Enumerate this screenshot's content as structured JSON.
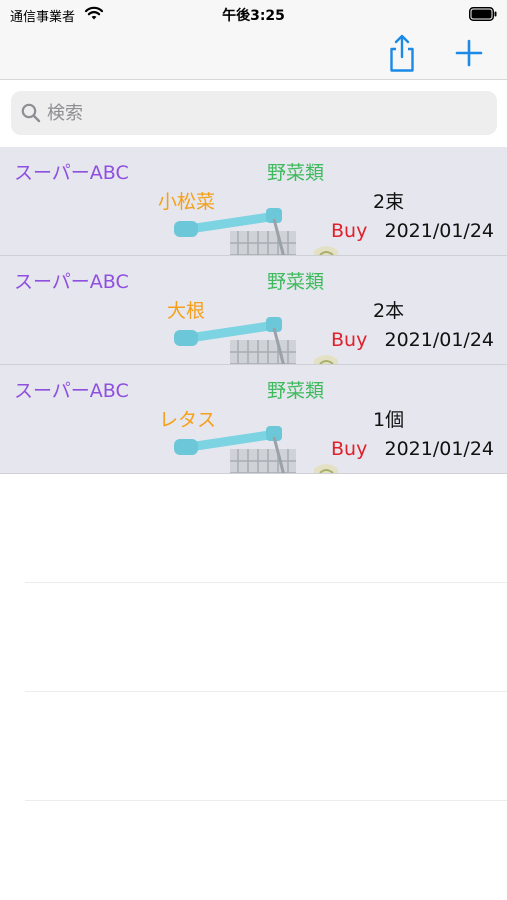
{
  "status_bar": {
    "carrier": "通信事業者",
    "time": "午後3:25"
  },
  "nav": {
    "share_icon": "share-icon",
    "add_icon": "plus-icon",
    "accent_color": "#1a8ae6"
  },
  "search": {
    "placeholder": "検索",
    "value": ""
  },
  "items": [
    {
      "store": "スーパーABC",
      "category": "野菜類",
      "name": "小松菜",
      "quantity": "2束",
      "status": "Buy",
      "date": "2021/01/24"
    },
    {
      "store": "スーパーABC",
      "category": "野菜類",
      "name": "大根",
      "quantity": "2本",
      "status": "Buy",
      "date": "2021/01/24"
    },
    {
      "store": "スーパーABC",
      "category": "野菜類",
      "name": "レタス",
      "quantity": "1個",
      "status": "Buy",
      "date": "2021/01/24"
    }
  ],
  "colors": {
    "store": "#8f4fe0",
    "category": "#3dbb5c",
    "item_name": "#f5a01a",
    "buy": "#e0202a",
    "row_background": "#e6e6ee"
  }
}
